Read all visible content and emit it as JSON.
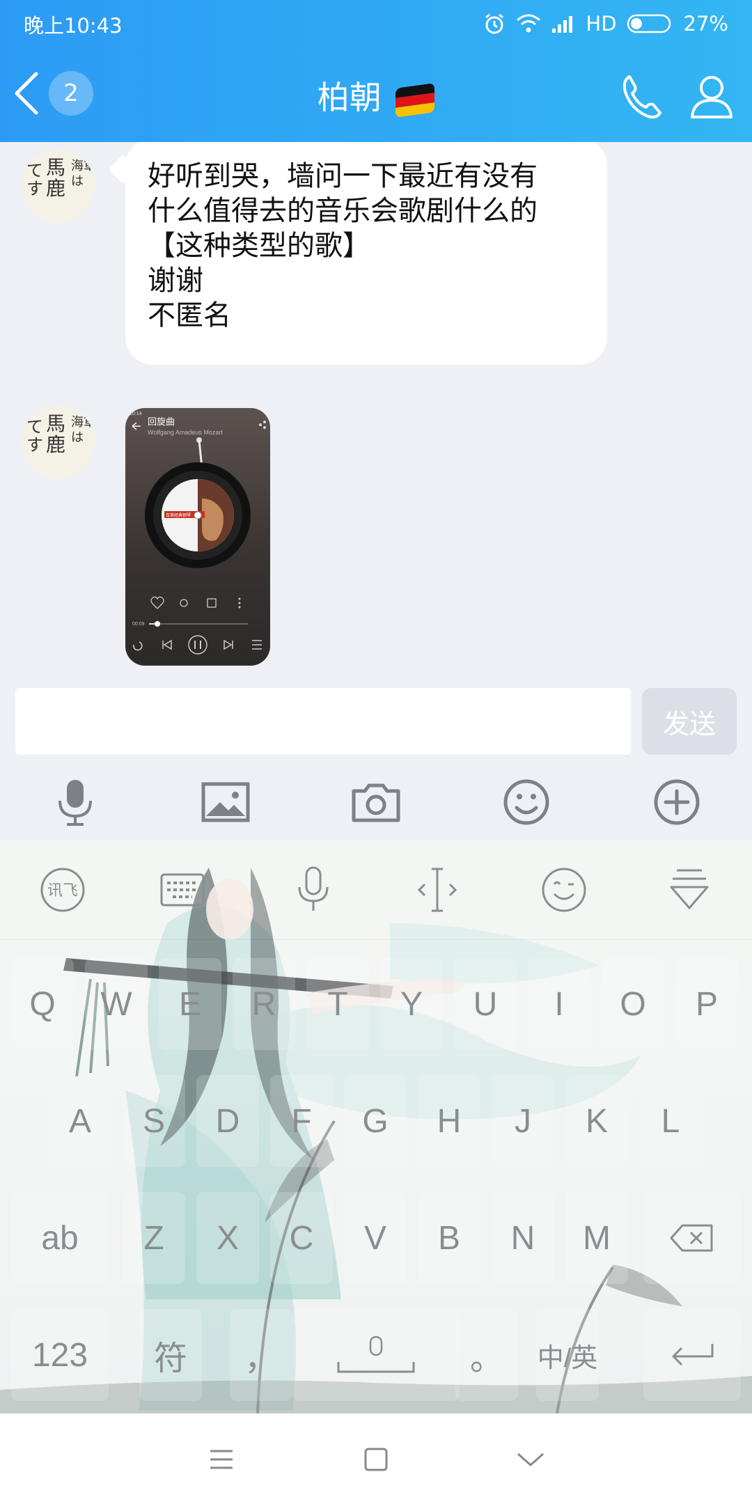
{
  "status_bar": {
    "time": "晚上10:43",
    "network_label": "HD",
    "battery_percent": "27%"
  },
  "header": {
    "back_badge_count": "2",
    "title": "柏朝",
    "flag": "german-flag",
    "colors": {
      "gradient_start": "#2d9bf5",
      "gradient_end": "#33b6f3"
    }
  },
  "messages": [
    {
      "type": "text",
      "lines": [
        "好听到哭，墙问一下最近有没有",
        "什么值得去的音乐会歌剧什么的",
        "【这种类型的歌】",
        "谢谢",
        "不匿名"
      ]
    },
    {
      "type": "image",
      "image_title": "回旋曲",
      "image_subtitle": "Wolfgang Amadeus Mozart",
      "image_time": "00:09"
    }
  ],
  "avatar_text": {
    "col1": "て\nす",
    "col2": "馬\n鹿",
    "col3": "海軍\nは"
  },
  "input": {
    "placeholder": "",
    "send_label": "发送"
  },
  "toolbar": {
    "items": [
      "mic-icon",
      "image-icon",
      "camera-icon",
      "emoji-icon",
      "plus-icon"
    ]
  },
  "keyboard": {
    "top_row_icons": [
      "xunfei-logo-icon",
      "keyboard-icon",
      "mic-icon",
      "cursor-icon",
      "emoji-icon",
      "collapse-icon"
    ],
    "row1": [
      "Q",
      "W",
      "E",
      "R",
      "T",
      "Y",
      "U",
      "I",
      "O",
      "P"
    ],
    "row2": [
      "A",
      "S",
      "D",
      "F",
      "G",
      "H",
      "J",
      "K",
      "L"
    ],
    "row3_left": "ab",
    "row3": [
      "Z",
      "X",
      "C",
      "V",
      "B",
      "N",
      "M"
    ],
    "row4_numbers": "123",
    "row4_symbols": "符",
    "row4_comma": "，",
    "row4_period": "。",
    "row4_lang": "中/英"
  },
  "navbar": {
    "items": [
      "menu-icon",
      "home-icon",
      "back-icon"
    ]
  }
}
